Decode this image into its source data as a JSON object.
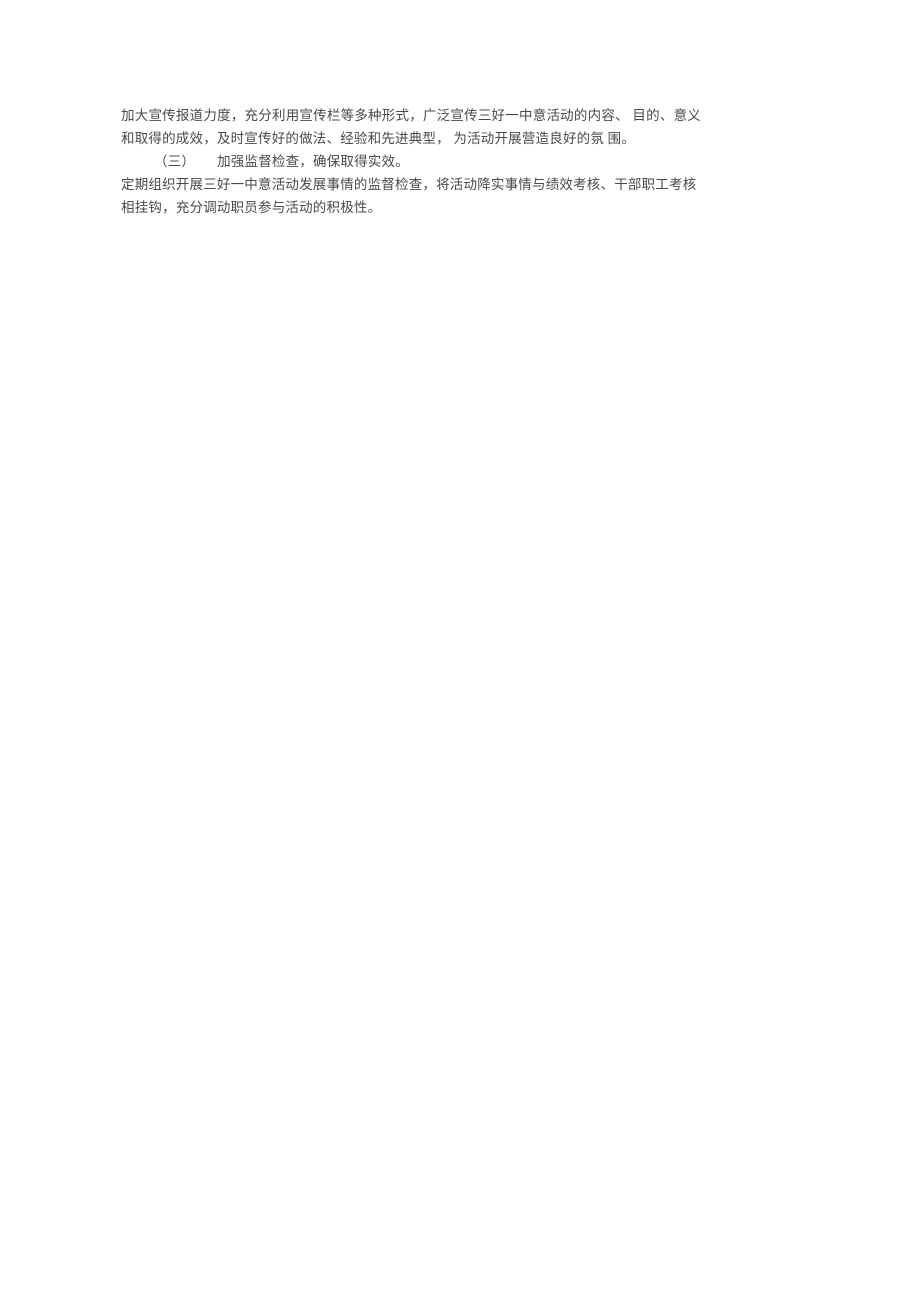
{
  "document": {
    "page_background": "#ffffff",
    "text_color": "#4a4a4a",
    "paragraphs": [
      {
        "id": "p1",
        "kind": "body",
        "text": "加大宣传报道力度，充分利用宣传栏等多种形式，广泛宣传三好一中意活动的内容、 目的、意义和取得的成效，及时宣传好的做法、经验和先进典型， 为活动开展营造良好的氛 围。"
      },
      {
        "id": "p2",
        "kind": "heading",
        "number": "（三）",
        "title": "加强监督检查，确保取得实效。"
      },
      {
        "id": "p3",
        "kind": "body",
        "text": "定期组织开展三好一中意活动发展事情的监督检查，将活动降实事情与绩效考核、干部职工考核相挂钩，充分调动职员参与活动的积极性。"
      }
    ]
  }
}
